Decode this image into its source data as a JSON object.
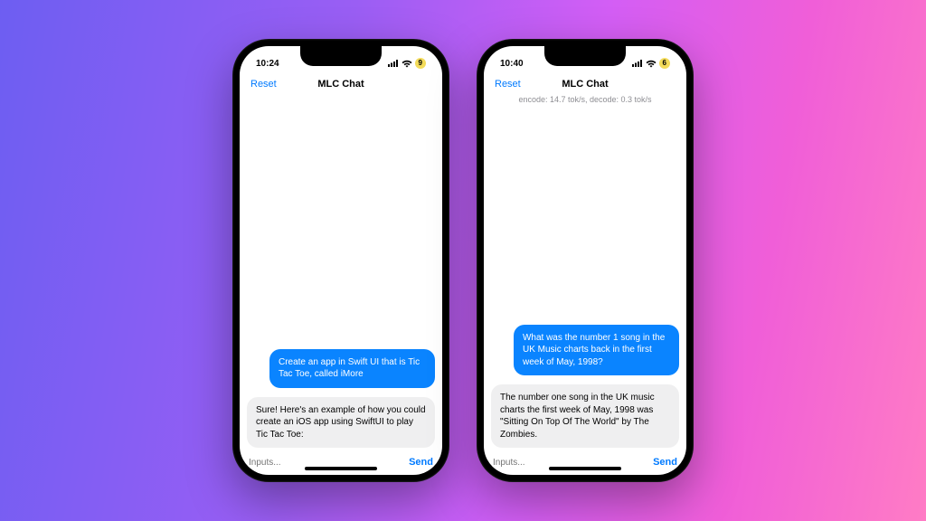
{
  "phones": [
    {
      "status": {
        "time": "10:24",
        "battery": "9"
      },
      "nav": {
        "reset": "Reset",
        "title": "MLC Chat"
      },
      "substatus": "",
      "messages": {
        "user": "Create an app in Swift UI that is Tic Tac Toe, called iMore",
        "assistant": "Sure! Here's an example of how you could create an iOS app using SwiftUI to play Tic Tac Toe:"
      },
      "input": {
        "placeholder": "Inputs...",
        "send": "Send"
      }
    },
    {
      "status": {
        "time": "10:40",
        "battery": "6"
      },
      "nav": {
        "reset": "Reset",
        "title": "MLC Chat"
      },
      "substatus": "encode: 14.7 tok/s, decode: 0.3 tok/s",
      "messages": {
        "user": "What was the number 1 song in the UK Music charts back in the first week of May, 1998?",
        "assistant": "The number one song in the UK music charts the first week of May, 1998 was \"Sitting On Top Of The World\" by The Zombies."
      },
      "input": {
        "placeholder": "Inputs...",
        "send": "Send"
      }
    }
  ]
}
